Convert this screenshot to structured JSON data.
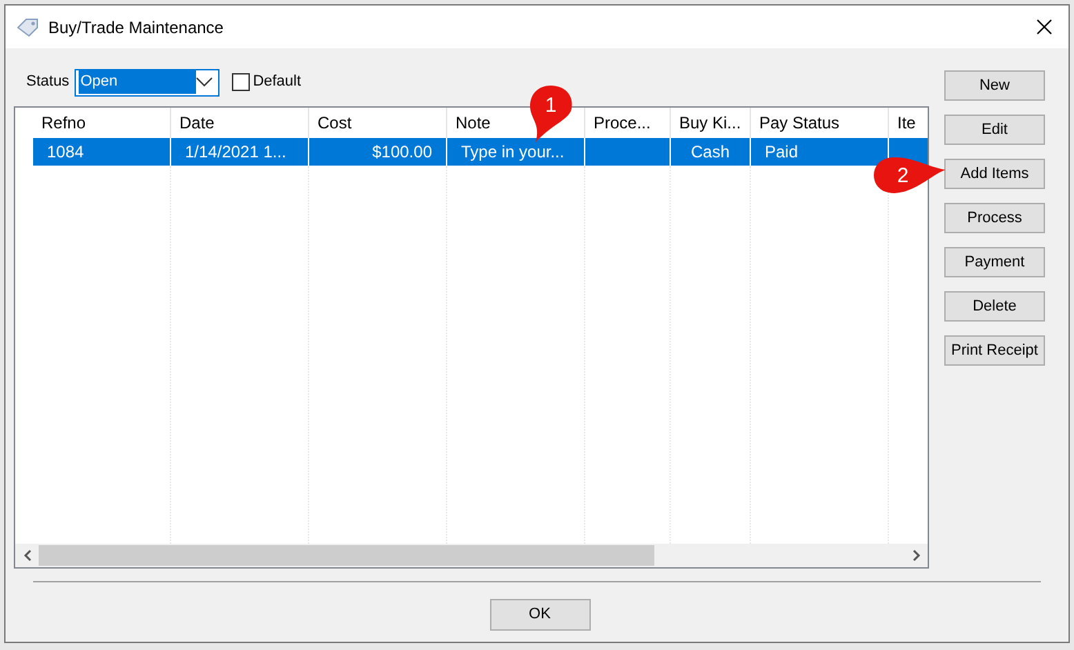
{
  "window": {
    "title": "Buy/Trade Maintenance"
  },
  "status": {
    "label": "Status",
    "value": "Open"
  },
  "default": {
    "label": "Default",
    "checked": false
  },
  "table": {
    "columns": [
      {
        "label": "Refno"
      },
      {
        "label": "Date"
      },
      {
        "label": "Cost"
      },
      {
        "label": "Note"
      },
      {
        "label": "Proce..."
      },
      {
        "label": "Buy Ki..."
      },
      {
        "label": "Pay Status"
      },
      {
        "label": "Ite"
      }
    ],
    "rows": [
      {
        "selected": true,
        "cells": [
          "1084",
          "1/14/2021 1...",
          "$100.00",
          "Type in your...",
          "",
          "Cash",
          "Paid",
          ""
        ]
      }
    ]
  },
  "buttons": [
    "New",
    "Edit",
    "Add Items",
    "Process",
    "Payment",
    "Delete",
    "Print Receipt"
  ],
  "ok": "OK",
  "callouts": [
    {
      "label": "1",
      "kind": "down"
    },
    {
      "label": "2",
      "kind": "right"
    }
  ]
}
